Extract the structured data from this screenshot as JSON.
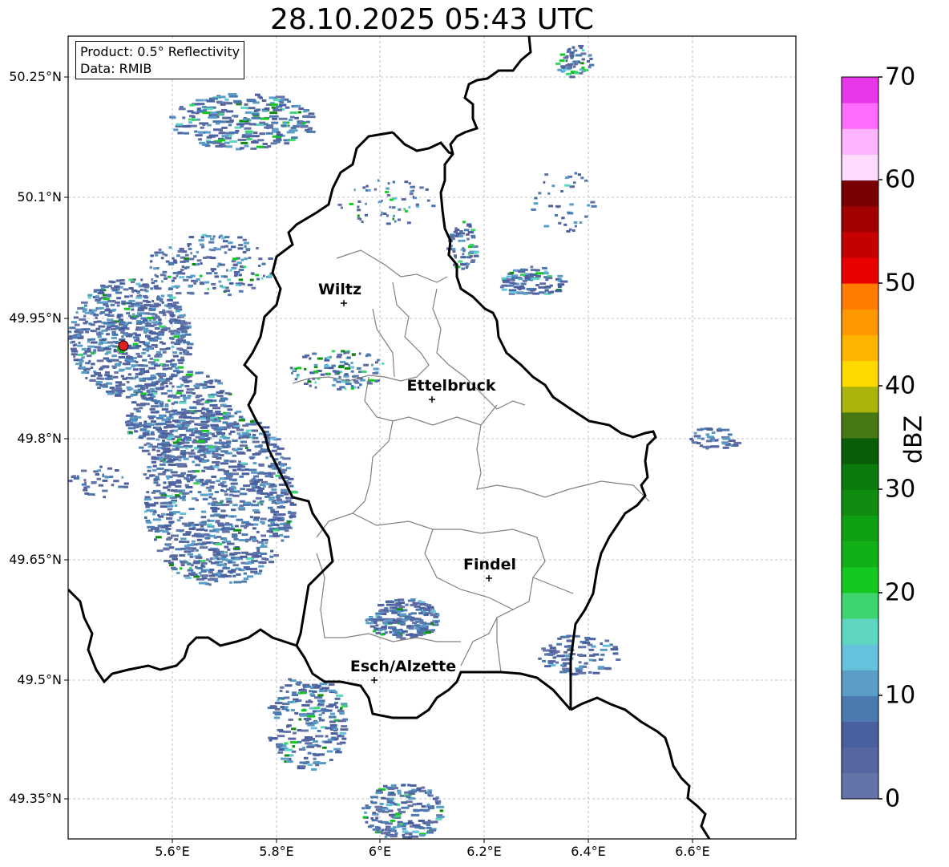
{
  "title": "28.10.2025 05:43 UTC",
  "info": {
    "product": "Product: 0.5° Reflectivity",
    "data": "Data: RMIB"
  },
  "lat_ticks": [
    "50.25°N",
    "50.1°N",
    "49.95°N",
    "49.8°N",
    "49.65°N",
    "49.5°N",
    "49.35°N"
  ],
  "lon_ticks": [
    "5.6°E",
    "5.8°E",
    "6°E",
    "6.2°E",
    "6.4°E",
    "6.6°E"
  ],
  "cities": [
    {
      "name": "Wiltz"
    },
    {
      "name": "Ettelbruck"
    },
    {
      "name": "Findel"
    },
    {
      "name": "Esch/Alzette"
    }
  ],
  "colorbar": {
    "label": "dBZ",
    "ticks": [
      "0",
      "10",
      "20",
      "30",
      "40",
      "50",
      "60",
      "70"
    ],
    "colors": [
      "#6574a8",
      "#5566a0",
      "#4a5fa0",
      "#4a7ab0",
      "#5a9ec8",
      "#66c2dc",
      "#5ed6c0",
      "#3ed46e",
      "#14c820",
      "#12b018",
      "#10a014",
      "#108c10",
      "#0c7a0c",
      "#085e08",
      "#467814",
      "#aab40a",
      "#ffd800",
      "#ffb400",
      "#ff9800",
      "#ff7c00",
      "#e80000",
      "#c40000",
      "#a00000",
      "#780000",
      "#ffdcff",
      "#ffb4ff",
      "#ff6cff",
      "#e836e8"
    ]
  },
  "radar_site": {
    "color": "#e02020"
  }
}
